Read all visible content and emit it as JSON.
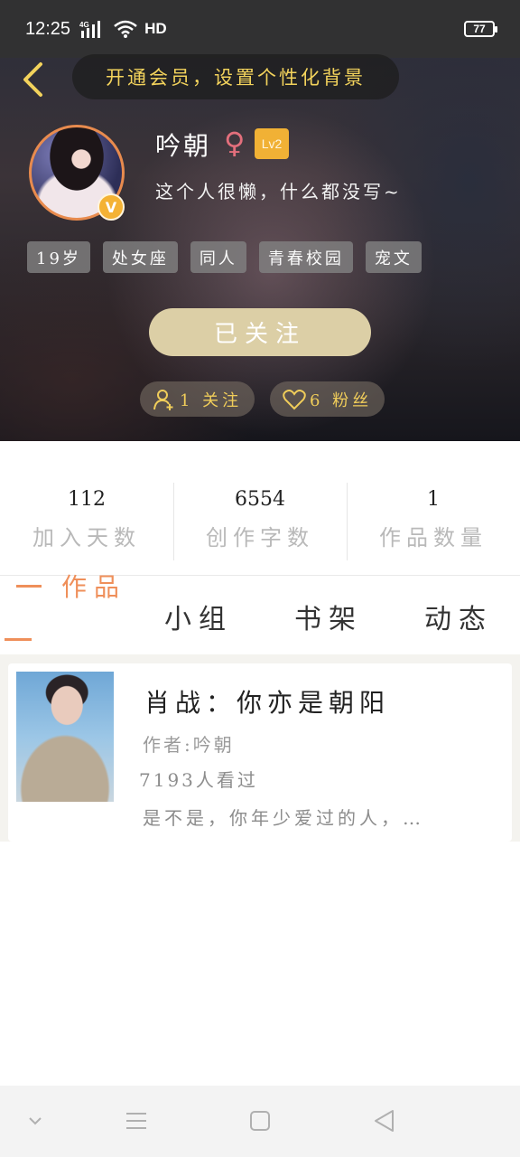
{
  "status_bar": {
    "time": "12:25",
    "network": "4G",
    "hd": "HD",
    "battery": "77"
  },
  "header": {
    "vip_banner": "开通会员，设置个性化背景"
  },
  "profile": {
    "name": "吟朝",
    "gender_symbol": "♀",
    "level": "Lv2",
    "badge": "V",
    "bio": "这个人很懒，什么都没写~",
    "tags": [
      "19岁",
      "处女座",
      "同人",
      "青春校园",
      "宠文"
    ],
    "follow_button": "已关注",
    "following": "1 关注",
    "fans": "6 粉丝"
  },
  "stats": [
    {
      "value": "112",
      "label": "加入天数"
    },
    {
      "value": "6554",
      "label": "创作字数"
    },
    {
      "value": "1",
      "label": "作品数量"
    }
  ],
  "tabs": [
    {
      "label": "作品",
      "active": true
    },
    {
      "label": "小组",
      "active": false
    },
    {
      "label": "书架",
      "active": false
    },
    {
      "label": "动态",
      "active": false
    }
  ],
  "works": [
    {
      "title": "肖战：你亦是朝阳",
      "author": "作者:吟朝",
      "views": "7193人看过",
      "summary": "是不是，你年少爱过的人，…"
    }
  ],
  "colors": {
    "accent": "#ef8f5a",
    "gold": "#f0cd5a",
    "follow_button": "#dccfa6",
    "level_badge": "#f1b135",
    "gender": "#e36f7c"
  }
}
